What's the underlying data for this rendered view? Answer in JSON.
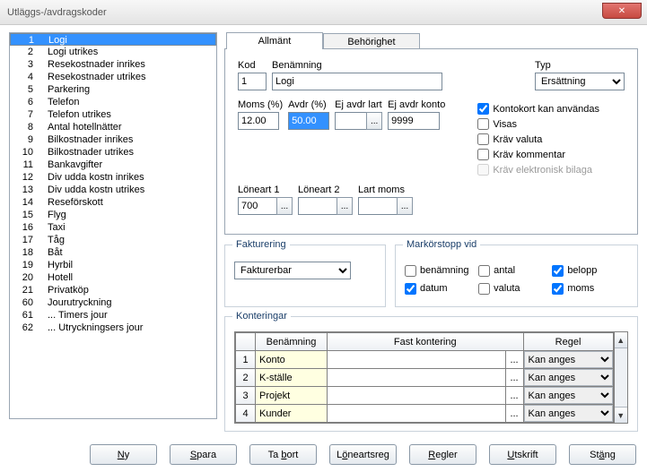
{
  "title": "Utläggs-/avdragskoder",
  "list": [
    {
      "num": "1",
      "label": "Logi",
      "selected": true
    },
    {
      "num": "2",
      "label": "Logi utrikes"
    },
    {
      "num": "3",
      "label": "Resekostnader inrikes"
    },
    {
      "num": "4",
      "label": "Resekostnader utrikes"
    },
    {
      "num": "5",
      "label": "Parkering"
    },
    {
      "num": "6",
      "label": "Telefon"
    },
    {
      "num": "7",
      "label": "Telefon utrikes"
    },
    {
      "num": "8",
      "label": "Antal hotellnätter"
    },
    {
      "num": "9",
      "label": "Bilkostnader inrikes"
    },
    {
      "num": "10",
      "label": "Bilkostnader utrikes"
    },
    {
      "num": "11",
      "label": "Bankavgifter"
    },
    {
      "num": "12",
      "label": "Div udda kostn inrikes"
    },
    {
      "num": "13",
      "label": "Div udda kostn utrikes"
    },
    {
      "num": "14",
      "label": "Reseförskott"
    },
    {
      "num": "15",
      "label": "Flyg"
    },
    {
      "num": "16",
      "label": "Taxi"
    },
    {
      "num": "17",
      "label": "Tåg"
    },
    {
      "num": "18",
      "label": "Båt"
    },
    {
      "num": "19",
      "label": "Hyrbil"
    },
    {
      "num": "20",
      "label": "Hotell"
    },
    {
      "num": "21",
      "label": "Privatköp"
    },
    {
      "num": "60",
      "label": "Jourutryckning"
    },
    {
      "num": "61",
      "label": "... Timers jour"
    },
    {
      "num": "62",
      "label": "... Utryckningsers jour"
    }
  ],
  "tabs": {
    "general": "Allmänt",
    "perm": "Behörighet"
  },
  "fields": {
    "kod_lbl": "Kod",
    "kod": "1",
    "ben_lbl": "Benämning",
    "ben": "Logi",
    "typ_lbl": "Typ",
    "typ": "Ersättning",
    "moms_lbl": "Moms (%)",
    "moms": "12.00",
    "avdr_lbl": "Avdr (%)",
    "avdr": "50.00",
    "ejavl_lbl": "Ej avdr lart",
    "ejavl": "",
    "ejavk_lbl": "Ej avdr konto",
    "ejavk": "9999",
    "l1_lbl": "Löneart 1",
    "l1": "700",
    "l2_lbl": "Löneart 2",
    "l2": "",
    "lm_lbl": "Lart moms",
    "lm": ""
  },
  "checks": {
    "kontokort": "Kontokort kan användas",
    "visas": "Visas",
    "kravvaluta": "Kräv valuta",
    "kravkomm": "Kräv kommentar",
    "kravelek": "Kräv elektronisk bilaga"
  },
  "fakturering": {
    "legend": "Fakturering",
    "value": "Fakturerbar"
  },
  "markor": {
    "legend": "Markörstopp vid",
    "benamning": "benämning",
    "antal": "antal",
    "belopp": "belopp",
    "datum": "datum",
    "valuta": "valuta",
    "moms": "moms"
  },
  "konteringar": {
    "legend": "Konteringar",
    "head_ben": "Benämning",
    "head_fast": "Fast kontering",
    "head_reg": "Regel",
    "rows": [
      {
        "n": "1",
        "ben": "Konto",
        "reg": "Kan anges"
      },
      {
        "n": "2",
        "ben": "K-ställe",
        "reg": "Kan anges"
      },
      {
        "n": "3",
        "ben": "Projekt",
        "reg": "Kan anges"
      },
      {
        "n": "4",
        "ben": "Kunder",
        "reg": "Kan anges"
      }
    ]
  },
  "buttons": {
    "ny": "Ny",
    "spara": "Spara",
    "tabort": "Ta bort",
    "loneartsreg": "Löneartsreg",
    "regler": "Regler",
    "utskrift": "Utskrift",
    "stang": "Stäng"
  },
  "ellipsis": "..."
}
